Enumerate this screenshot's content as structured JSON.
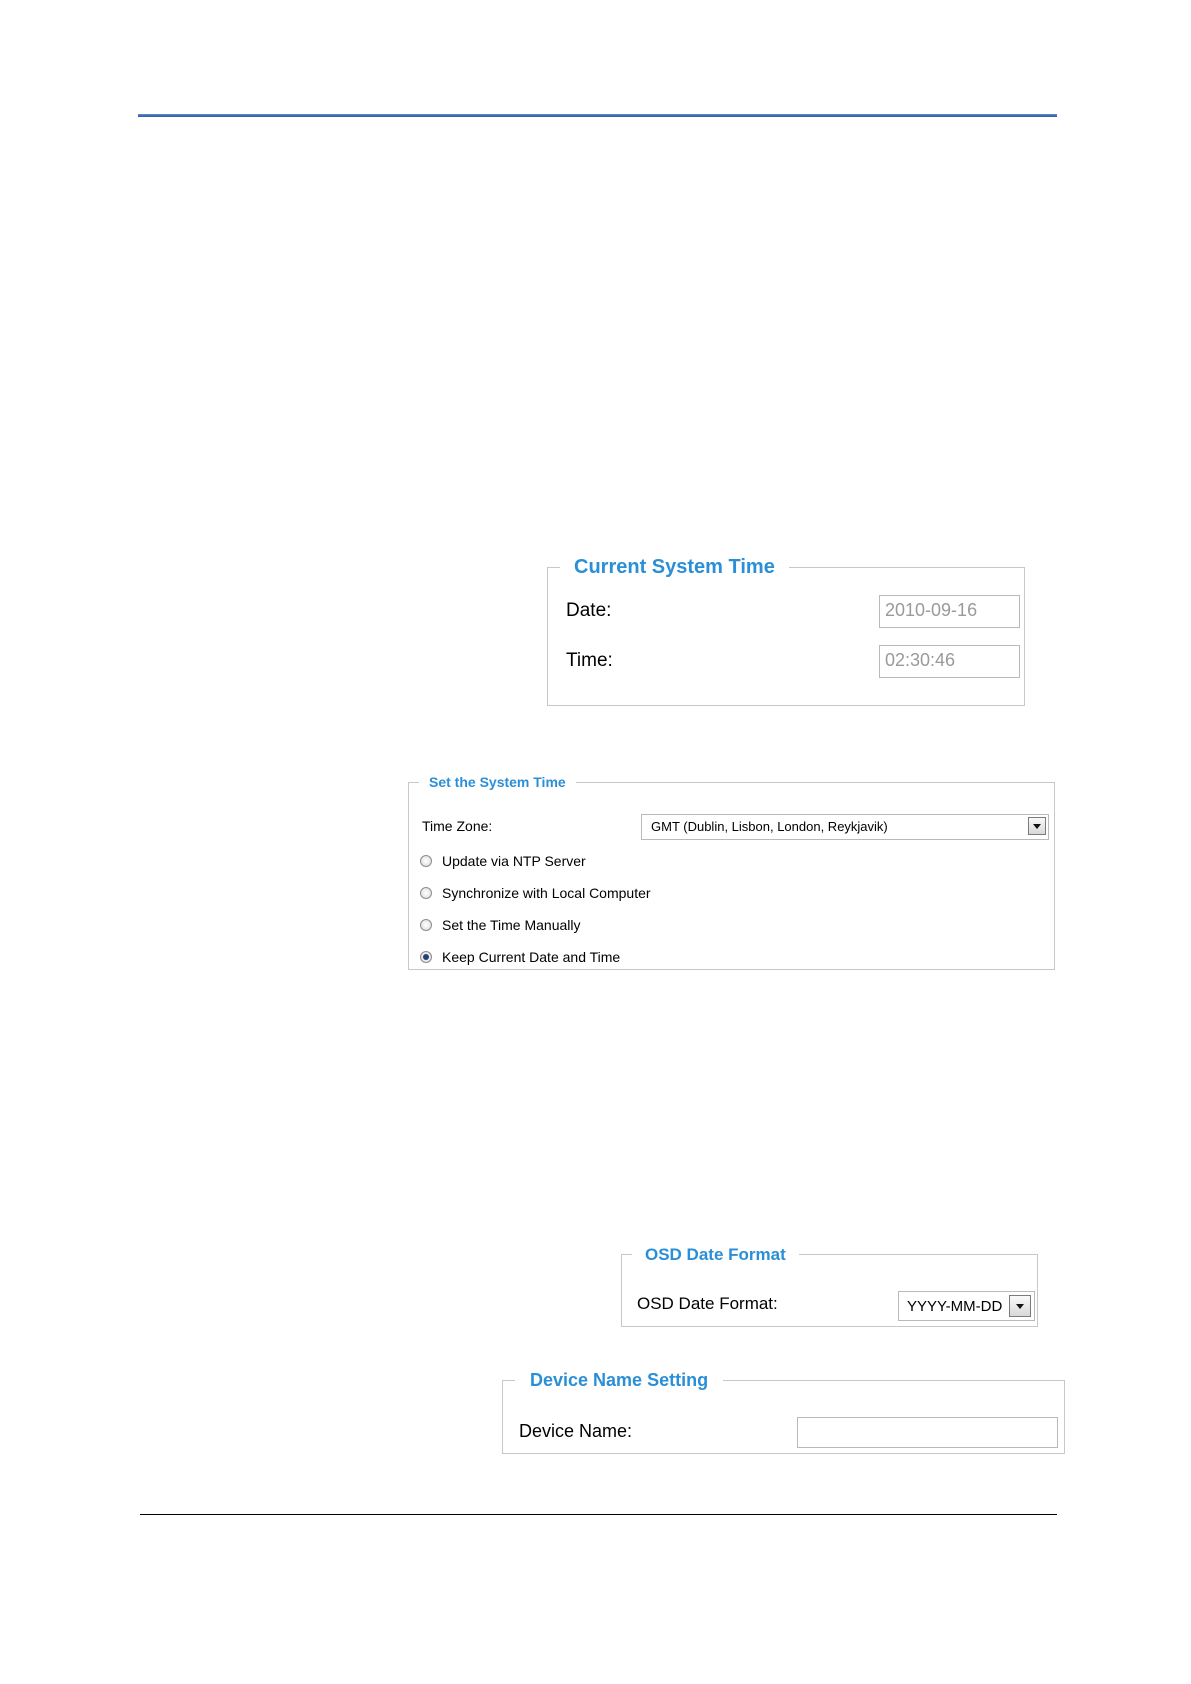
{
  "current_system_time": {
    "title": "Current System Time",
    "date_label": "Date:",
    "date_value": "2010-09-16",
    "time_label": "Time:",
    "time_value": "02:30:46"
  },
  "set_system_time": {
    "title": "Set the System Time",
    "time_zone_label": "Time Zone:",
    "time_zone_value": "GMT (Dublin, Lisbon, London, Reykjavik)",
    "options": [
      {
        "label": "Update via NTP Server",
        "selected": false
      },
      {
        "label": "Synchronize with Local Computer",
        "selected": false
      },
      {
        "label": "Set the Time Manually",
        "selected": false
      },
      {
        "label": "Keep Current Date and Time",
        "selected": true
      }
    ]
  },
  "osd_date_format": {
    "title": "OSD Date Format",
    "label": "OSD Date Format:",
    "value": "YYYY-MM-DD"
  },
  "device_name_setting": {
    "title": "Device Name Setting",
    "label": "Device Name:",
    "value": ""
  },
  "colors": {
    "legend": "#2a8fd6",
    "header_rule": "#2c5aa0"
  }
}
